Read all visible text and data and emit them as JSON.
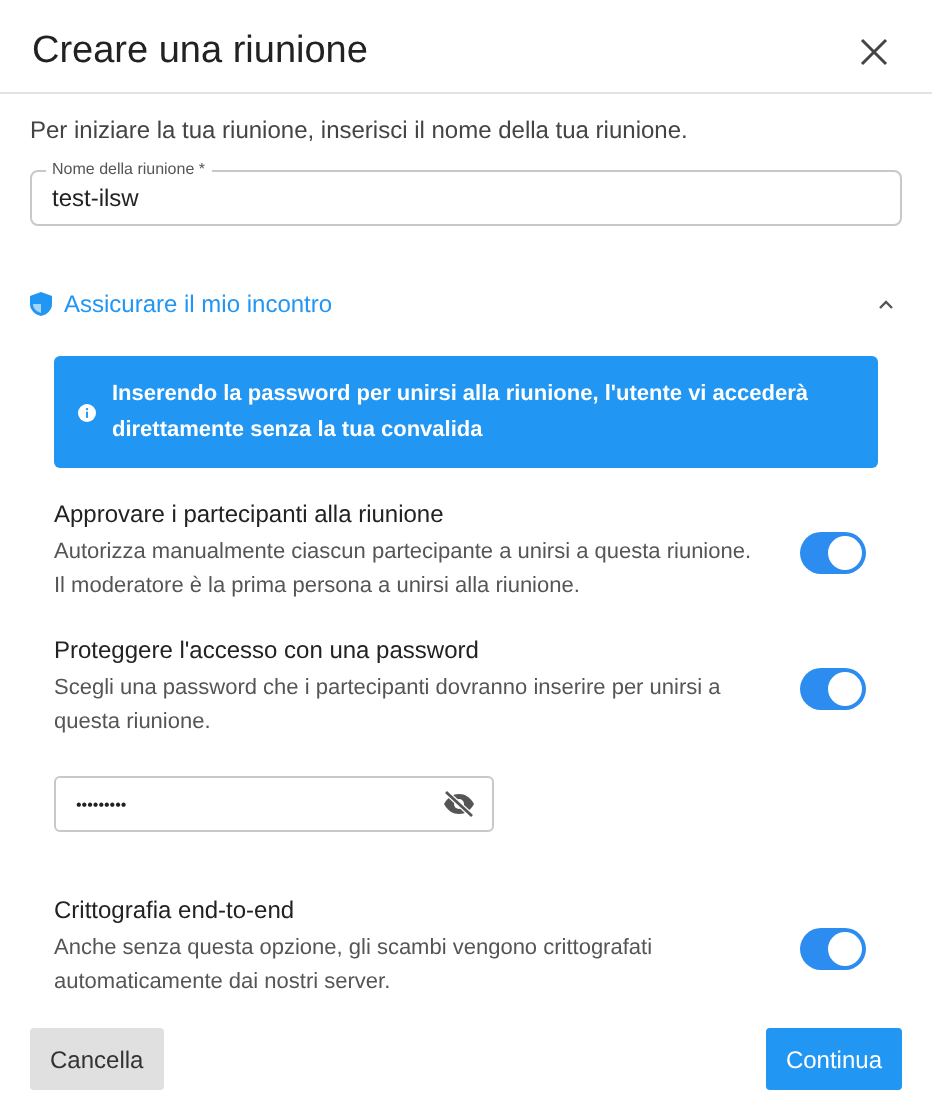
{
  "dialog": {
    "title": "Creare una riunione",
    "intro": "Per iniziare la tua riunione, inserisci il nome della tua riunione.",
    "name_field": {
      "label": "Nome della riunione *",
      "value": "test-ilsw"
    },
    "security": {
      "title": "Assicurare il mio incontro",
      "expanded": true,
      "notice": "Inserendo la password per unirsi alla riunione, l'utente vi accederà direttamente senza la tua convalida",
      "options": [
        {
          "title": "Approvare i partecipanti alla riunione",
          "description": "Autorizza manualmente ciascun partecipante a unirsi a questa riunione. Il moderatore è la prima persona a unirsi alla riunione.",
          "on": true
        },
        {
          "title": "Proteggere l'accesso con una password",
          "description": "Scegli una password che i partecipanti dovranno inserire per unirsi a questa riunione.",
          "on": true,
          "password_field": {
            "value": "•••••••••"
          }
        },
        {
          "title": "Crittografia end-to-end",
          "description": "Anche senza questa opzione, gli scambi vengono crittografati automaticamente dai nostri server.",
          "on": true
        }
      ]
    },
    "buttons": [
      {
        "label": "Cancella",
        "kind": "secondary"
      },
      {
        "label": "Continua",
        "kind": "primary"
      }
    ]
  }
}
